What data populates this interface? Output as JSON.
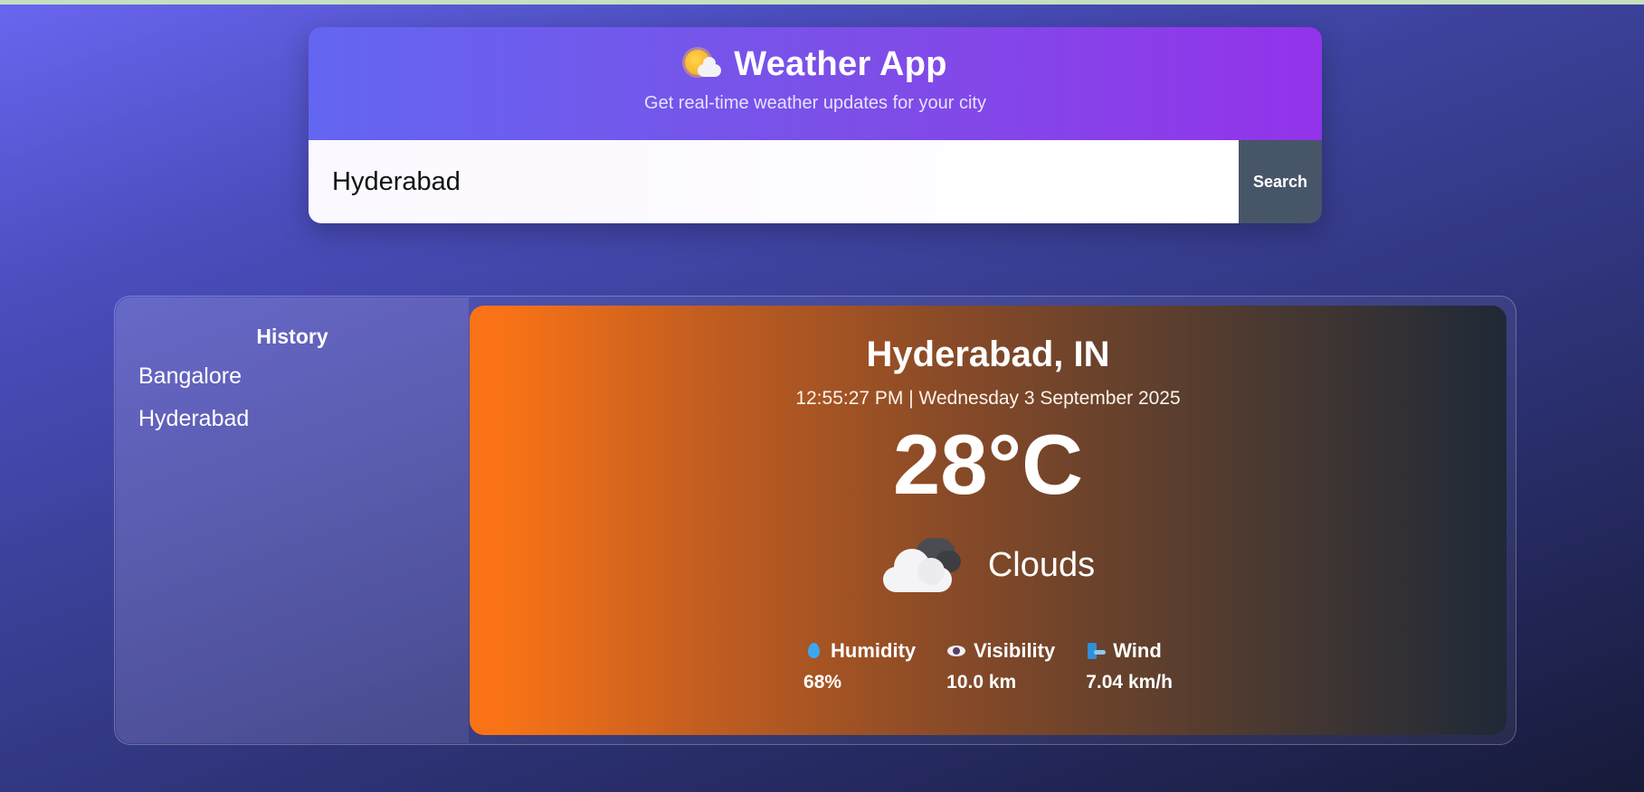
{
  "header": {
    "title": "Weather App",
    "subtitle": "Get real-time weather updates for your city",
    "icon": "sun-behind-cloud-icon"
  },
  "search": {
    "value": "Hyderabad",
    "button_label": "Search"
  },
  "history": {
    "title": "History",
    "items": [
      "Bangalore",
      "Hyderabad"
    ]
  },
  "weather": {
    "city": "Hyderabad, IN",
    "datetime": "12:55:27 PM | Wednesday 3 September 2025",
    "temperature": "28°C",
    "condition": "Clouds",
    "condition_icon": "clouds-icon",
    "stats": {
      "humidity_label": "Humidity",
      "humidity_value": "68%",
      "visibility_label": "Visibility",
      "visibility_value": "10.0 km",
      "wind_label": "Wind",
      "wind_value": "7.04 km/h"
    }
  },
  "colors": {
    "header_gradient_start": "#6366f1",
    "header_gradient_end": "#9333ea",
    "search_button": "#475569",
    "card_gradient_start": "#f97316",
    "card_gradient_end": "#1f2937"
  }
}
